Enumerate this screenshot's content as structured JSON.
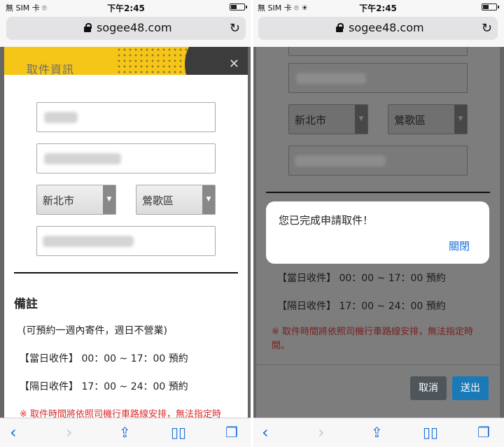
{
  "status_left": {
    "carrier": "無 SIM 卡 ⌾",
    "time": "下午2:45"
  },
  "status_right": {
    "carrier": "無 SIM 卡 ⌾ ☀",
    "time": "下午2:45"
  },
  "url": {
    "domain": "sogee48.com"
  },
  "modal": {
    "title": "取件資訊",
    "city": "新北市",
    "district": "鶯歌區",
    "note_heading": "備註",
    "note_lines": [
      "(可預約一週內寄件，週日不營業)",
      "【當日收件】 00：00 ~ 17：00 預約",
      "【隔日收件】 17：00 ~ 24：00 預約"
    ],
    "warning": "※ 取件時間將依照司機行車路線安排，無法指定時"
  },
  "right": {
    "city": "新北市",
    "district": "鶯歌區",
    "line_today": "【當日收件】 00：00 ~ 17：00 預約",
    "line_next": "【隔日收件】 17：00 ~ 24：00 預約",
    "warning_1": "※ 取件時間將依照司機行車路線安排，無法指定時",
    "warning_2": "間。",
    "cancel_label": "取消",
    "submit_label": "送出",
    "alert_message": "您已完成申請取件！",
    "alert_close": "關閉"
  },
  "icons": [
    "lock-icon",
    "reload-icon",
    "back-icon",
    "forward-icon",
    "share-icon",
    "bookmarks-icon",
    "tabs-icon",
    "close-icon"
  ],
  "colors": {
    "accent": "#1a6fd8",
    "header_yellow": "#f5c518",
    "warning_red": "#d92b2b",
    "submit_blue": "#1a7ab8",
    "cancel_gray": "#4f565b"
  }
}
